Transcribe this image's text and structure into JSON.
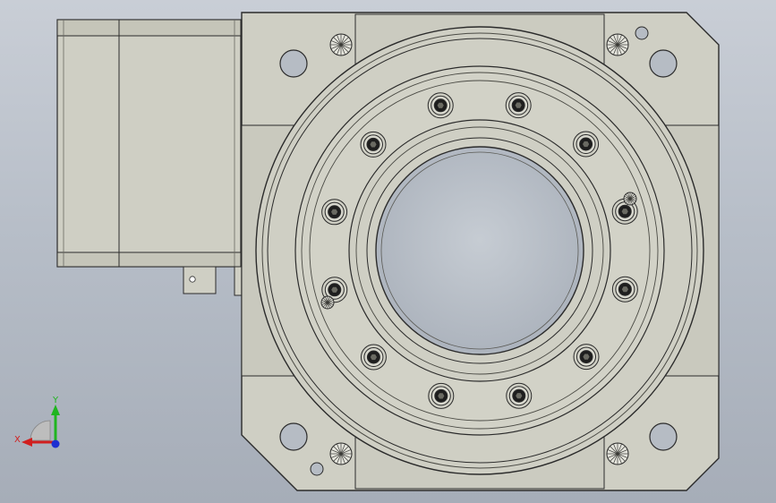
{
  "viewport": {
    "background_top": "#c9ced6",
    "background_bottom": "#a6adb8"
  },
  "part": {
    "body_color": "#cfcfc4",
    "edge_color": "#2b2b2b",
    "bore_color": "#b6bcc4",
    "bolt_hole_count": 12,
    "components": [
      "rotary-table-housing",
      "servo-motor",
      "flange-plate",
      "center-bore"
    ]
  },
  "triad": {
    "x_label": "X",
    "y_label": "Y",
    "x_color": "#d11f1f",
    "y_color": "#1fb51f",
    "z_color": "#1f2fd1"
  }
}
